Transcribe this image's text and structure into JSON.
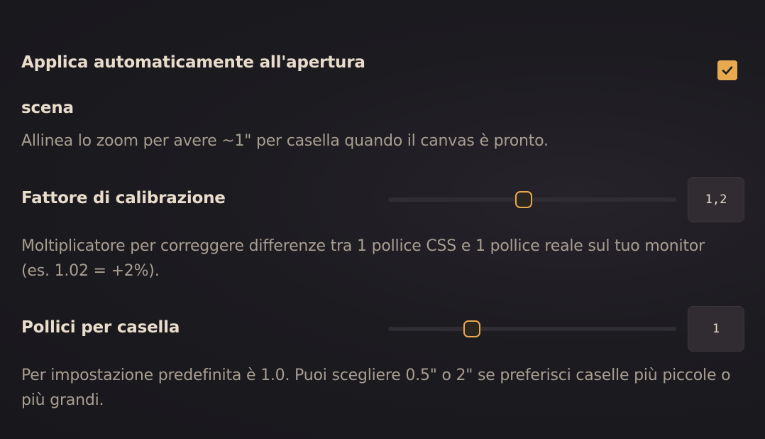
{
  "auto_apply": {
    "title_line1": "Applica automaticamente all'apertura",
    "title_line2": "scena",
    "checked": true,
    "description": "Allinea lo zoom per avere ~1\" per casella quando il canvas è pronto."
  },
  "calibration": {
    "label": "Fattore di calibrazione",
    "value": "1,2",
    "slider_fraction": 0.47,
    "description": "Moltiplicatore per correggere differenze tra 1 pollice CSS e 1 pollice reale sul tuo monitor (es. 1.02 = +2%)."
  },
  "inches_per_cell": {
    "label": "Pollici per casella",
    "value": "1",
    "slider_fraction": 0.29,
    "description": "Per impostazione predefinita è 1.0. Puoi scegliere 0.5\" o 2\" se preferisci caselle più piccole o più grandi."
  },
  "colors": {
    "accent": "#e9a94f",
    "background": "#1c1b20",
    "label_text": "#e8dccb",
    "description_text": "#a89e92",
    "input_background": "#302c31"
  },
  "icons": {
    "checkbox": "check-icon"
  }
}
